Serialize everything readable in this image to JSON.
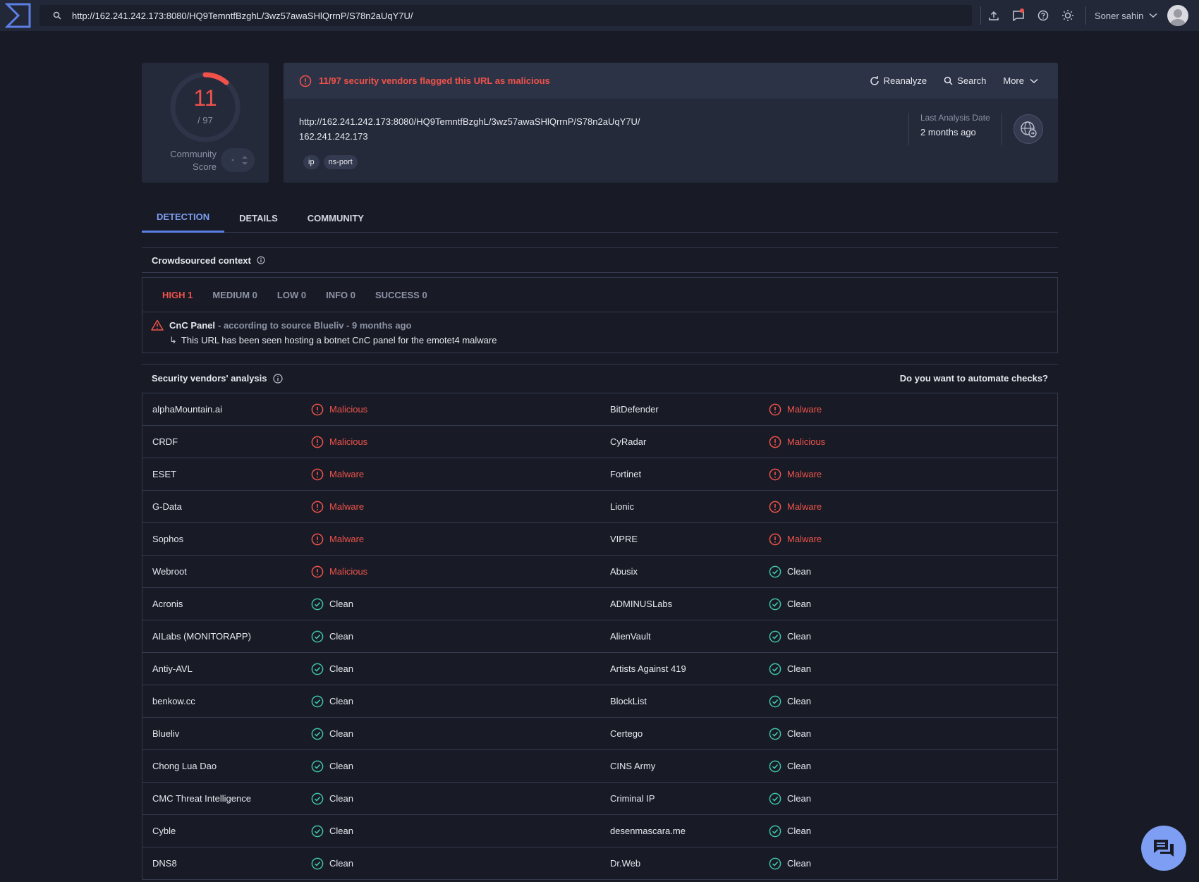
{
  "topbar": {
    "url": "http://162.241.242.173:8080/HQ9TemntfBzghL/3wz57awaSHlQrrnP/S78n2aUqY7U/",
    "user_name": "Soner sahin"
  },
  "score": {
    "detected": "11",
    "total": "/ 97",
    "ratio": 0.113,
    "community_label_1": "Community",
    "community_label_2": "Score"
  },
  "header": {
    "alert": "11/97 security vendors flagged this URL as malicious",
    "reanalyze": "Reanalyze",
    "search": "Search",
    "more": "More",
    "url": "http://162.241.242.173:8080/HQ9TemntfBzghL/3wz57awaSHlQrrnP/S78n2aUqY7U/",
    "ip": "162.241.242.173",
    "tags": [
      "ip",
      "ns-port"
    ],
    "last_analysis_label": "Last Analysis Date",
    "last_analysis_value": "2 months ago"
  },
  "tabs": [
    "DETECTION",
    "DETAILS",
    "COMMUNITY"
  ],
  "crowdsourced": {
    "title": "Crowdsourced context",
    "tabs": [
      "HIGH 1",
      "MEDIUM 0",
      "LOW 0",
      "INFO 0",
      "SUCCESS 0"
    ],
    "item_title": "CnC Panel",
    "item_source": "- according to source Blueliv - 9 months ago",
    "item_desc": "This URL has been seen hosting a botnet CnC panel for the emotet4 malware"
  },
  "vendors": {
    "title": "Security vendors' analysis",
    "automate": "Do you want to automate checks?",
    "rows": [
      [
        {
          "name": "alphaMountain.ai",
          "result": "Malicious",
          "status": "bad"
        },
        {
          "name": "BitDefender",
          "result": "Malware",
          "status": "bad"
        }
      ],
      [
        {
          "name": "CRDF",
          "result": "Malicious",
          "status": "bad"
        },
        {
          "name": "CyRadar",
          "result": "Malicious",
          "status": "bad"
        }
      ],
      [
        {
          "name": "ESET",
          "result": "Malware",
          "status": "bad"
        },
        {
          "name": "Fortinet",
          "result": "Malware",
          "status": "bad"
        }
      ],
      [
        {
          "name": "G-Data",
          "result": "Malware",
          "status": "bad"
        },
        {
          "name": "Lionic",
          "result": "Malware",
          "status": "bad"
        }
      ],
      [
        {
          "name": "Sophos",
          "result": "Malware",
          "status": "bad"
        },
        {
          "name": "VIPRE",
          "result": "Malware",
          "status": "bad"
        }
      ],
      [
        {
          "name": "Webroot",
          "result": "Malicious",
          "status": "bad"
        },
        {
          "name": "Abusix",
          "result": "Clean",
          "status": "good"
        }
      ],
      [
        {
          "name": "Acronis",
          "result": "Clean",
          "status": "good"
        },
        {
          "name": "ADMINUSLabs",
          "result": "Clean",
          "status": "good"
        }
      ],
      [
        {
          "name": "AILabs (MONITORAPP)",
          "result": "Clean",
          "status": "good"
        },
        {
          "name": "AlienVault",
          "result": "Clean",
          "status": "good"
        }
      ],
      [
        {
          "name": "Antiy-AVL",
          "result": "Clean",
          "status": "good"
        },
        {
          "name": "Artists Against 419",
          "result": "Clean",
          "status": "good"
        }
      ],
      [
        {
          "name": "benkow.cc",
          "result": "Clean",
          "status": "good"
        },
        {
          "name": "BlockList",
          "result": "Clean",
          "status": "good"
        }
      ],
      [
        {
          "name": "Blueliv",
          "result": "Clean",
          "status": "good"
        },
        {
          "name": "Certego",
          "result": "Clean",
          "status": "good"
        }
      ],
      [
        {
          "name": "Chong Lua Dao",
          "result": "Clean",
          "status": "good"
        },
        {
          "name": "CINS Army",
          "result": "Clean",
          "status": "good"
        }
      ],
      [
        {
          "name": "CMC Threat Intelligence",
          "result": "Clean",
          "status": "good"
        },
        {
          "name": "Criminal IP",
          "result": "Clean",
          "status": "good"
        }
      ],
      [
        {
          "name": "Cyble",
          "result": "Clean",
          "status": "good"
        },
        {
          "name": "desenmascara.me",
          "result": "Clean",
          "status": "good"
        }
      ],
      [
        {
          "name": "DNS8",
          "result": "Clean",
          "status": "good"
        },
        {
          "name": "Dr.Web",
          "result": "Clean",
          "status": "good"
        }
      ]
    ]
  },
  "colors": {
    "malicious": "#f0524a",
    "clean": "#3fc2a8",
    "accent": "#7d9ef2"
  }
}
